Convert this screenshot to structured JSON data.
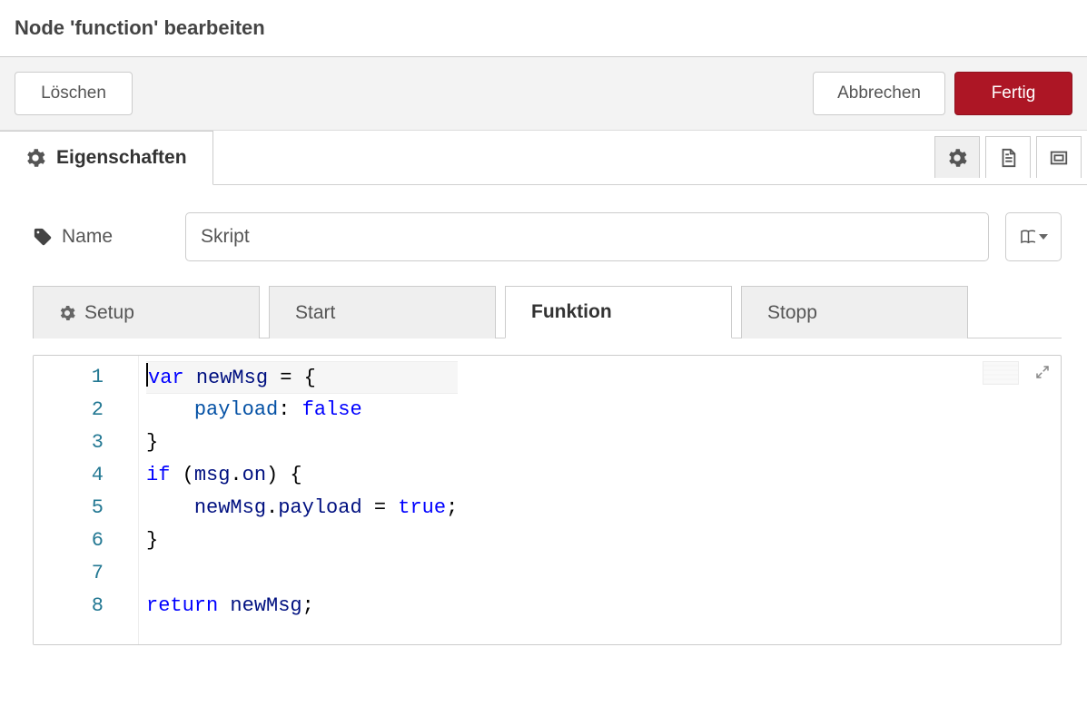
{
  "header": {
    "title": "Node 'function' bearbeiten"
  },
  "toolbar": {
    "delete_label": "Löschen",
    "cancel_label": "Abbrechen",
    "done_label": "Fertig"
  },
  "main_tabs": {
    "properties_label": "Eigenschaften"
  },
  "form": {
    "name_label": "Name",
    "name_value": "Skript"
  },
  "inner_tabs": {
    "setup": "Setup",
    "start": "Start",
    "function": "Funktion",
    "stop": "Stopp",
    "active": "function"
  },
  "editor": {
    "line_numbers": [
      "1",
      "2",
      "3",
      "4",
      "5",
      "6",
      "7",
      "8"
    ],
    "code_lines": [
      [
        {
          "t": "var ",
          "c": "kw"
        },
        {
          "t": "newMsg",
          "c": "id"
        },
        {
          "t": " = {",
          "c": "punc"
        }
      ],
      [
        {
          "t": "    ",
          "c": "punc"
        },
        {
          "t": "payload",
          "c": "prop"
        },
        {
          "t": ": ",
          "c": "punc"
        },
        {
          "t": "false",
          "c": "lit"
        }
      ],
      [
        {
          "t": "}",
          "c": "punc"
        }
      ],
      [
        {
          "t": "if ",
          "c": "kw"
        },
        {
          "t": "(",
          "c": "punc"
        },
        {
          "t": "msg",
          "c": "id"
        },
        {
          "t": ".",
          "c": "punc"
        },
        {
          "t": "on",
          "c": "id"
        },
        {
          "t": ") {",
          "c": "punc"
        }
      ],
      [
        {
          "t": "    ",
          "c": "punc"
        },
        {
          "t": "newMsg",
          "c": "id"
        },
        {
          "t": ".",
          "c": "punc"
        },
        {
          "t": "payload",
          "c": "id"
        },
        {
          "t": " = ",
          "c": "punc"
        },
        {
          "t": "true",
          "c": "lit"
        },
        {
          "t": ";",
          "c": "punc"
        }
      ],
      [
        {
          "t": "}",
          "c": "punc"
        }
      ],
      [
        {
          "t": "",
          "c": "punc"
        }
      ],
      [
        {
          "t": "return ",
          "c": "kw"
        },
        {
          "t": "newMsg",
          "c": "id"
        },
        {
          "t": ";",
          "c": "punc"
        }
      ]
    ],
    "cursor_line": 0
  },
  "colors": {
    "primary": "#AD1625"
  }
}
